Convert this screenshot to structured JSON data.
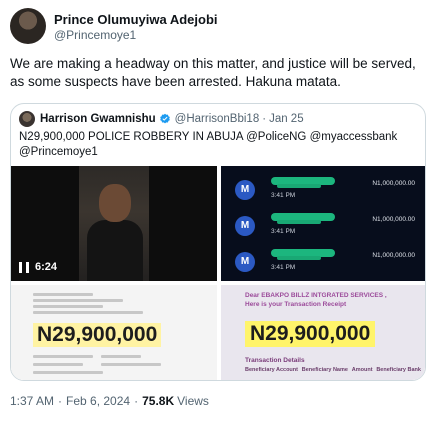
{
  "post": {
    "author_name": "Prince Olumuyiwa Adejobi",
    "author_handle": "@Princemoye1",
    "text": "We are making a headway on this matter, and justice will be served, as some suspects have been arrested. Hakuna matata.",
    "time": "1:37 AM",
    "date": "Feb 6, 2024",
    "views_count": "75.8K",
    "views_label": "Views"
  },
  "quote": {
    "author_name": "Harrison Gwamnishu",
    "verified_icon": "verified-badge-icon",
    "author_handle": "@HarrisonBbi18",
    "date": "Jan 25",
    "text": "N29,900,000 POLICE ROBBERY IN ABUJA @PoliceNG @myaccessbank @Princemoye1",
    "media": {
      "video_duration": "6:24",
      "transactions": [
        {
          "time": "3:41 PM",
          "amount": "N1,000,000.00"
        },
        {
          "time": "3:41 PM",
          "amount": "N1,000,000.00"
        },
        {
          "time": "3:41 PM",
          "amount": "N1,000,000.00"
        }
      ],
      "transfer_amount": "N29,900,000",
      "receipt_title_line1": "Dear EBAKPO BILLZ INTGRATED SERVICES ,",
      "receipt_title_line2": "Here is your Transaction Receipt",
      "receipt_amount": "N29,900,000",
      "transaction_details_label": "Transaction Details",
      "detail_columns": [
        "Beneficiary Account",
        "Beneficiary Name",
        "Amount",
        "Beneficiary Bank"
      ]
    }
  },
  "colors": {
    "text_primary": "#0f1419",
    "text_secondary": "#536471",
    "verified_blue": "#1d9bf0",
    "highlight_yellow": "#fff46a"
  }
}
